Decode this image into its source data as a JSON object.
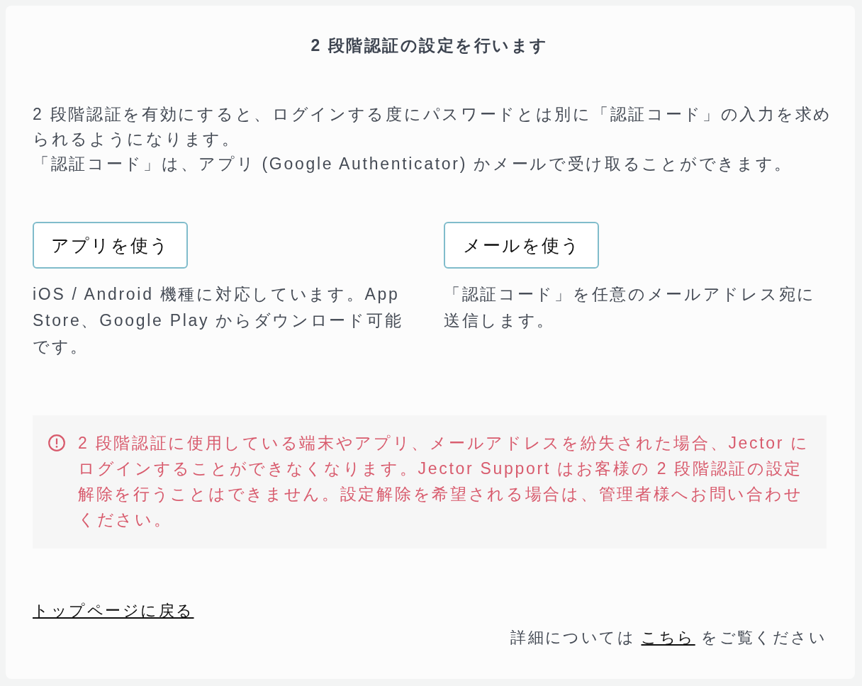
{
  "title": "2 段階認証の設定を行います",
  "intro": [
    "2 段階認証を有効にすると、ログインする度にパスワードとは別に「認証コード」の入力を求められるようになります。",
    "「認証コード」は、アプリ (Google Authenticator) かメールで受け取ることができます。"
  ],
  "options": [
    {
      "button": "アプリを使う",
      "description": "iOS / Android 機種に対応しています。App Store、Google Play からダウンロード可能です。"
    },
    {
      "button": "メールを使う",
      "description": "「認証コード」を任意のメールアドレス宛に送信します。"
    }
  ],
  "warning": {
    "text": "2 段階認証に使用している端末やアプリ、メールアドレスを紛失された場合、Jector にログインすることができなくなります。Jector Support はお客様の 2 段階認証の設定解除を行うことはできません。設定解除を希望される場合は、管理者様へお問い合わせください。"
  },
  "back_link": "トップページに戻る",
  "details": {
    "before": "詳細については",
    "link": "こちら",
    "after": "をご覧ください"
  }
}
